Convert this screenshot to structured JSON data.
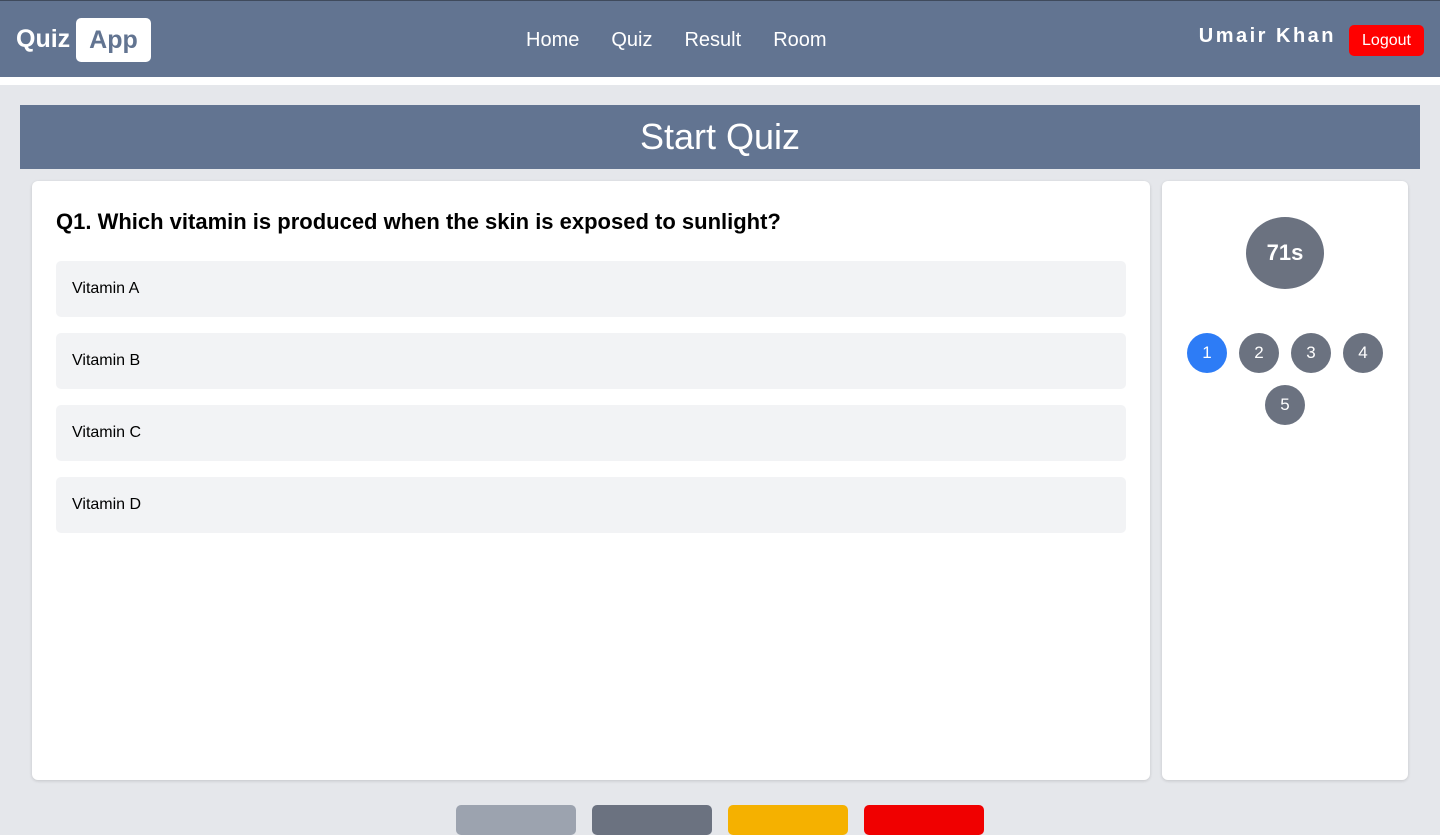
{
  "header": {
    "logo_part1": "Quiz",
    "logo_part2": "App",
    "nav": [
      "Home",
      "Quiz",
      "Result",
      "Room"
    ],
    "user_name": "Umair Khan",
    "logout_label": "Logout"
  },
  "banner": {
    "title": "Start Quiz"
  },
  "question": {
    "title": "Q1. Which vitamin is produced when the skin is exposed to sunlight?",
    "options": [
      "Vitamin A",
      "Vitamin B",
      "Vitamin C",
      "Vitamin D"
    ]
  },
  "sidebar": {
    "timer": "71s",
    "question_numbers": [
      "1",
      "2",
      "3",
      "4",
      "5"
    ],
    "active_question": "1"
  },
  "bottom_buttons": {
    "colors": [
      "#9ca3af",
      "#6b7280",
      "#f5b100",
      "#f00000"
    ]
  },
  "colors": {
    "header_bg": "#627491",
    "logout_bg": "#ff0000",
    "active_number": "#2d7cf6",
    "inactive_number": "#6b7280"
  }
}
